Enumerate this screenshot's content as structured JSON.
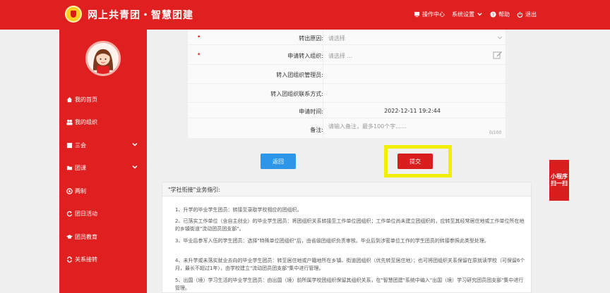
{
  "header": {
    "title": "网上共青团・智慧团建",
    "nav": {
      "operation_center": "操作中心",
      "system_settings": "系统设置",
      "help": "帮助",
      "logout": "退出"
    }
  },
  "sidebar": {
    "items": [
      {
        "label": "我的首页"
      },
      {
        "label": "我的组织"
      },
      {
        "label": "三会"
      },
      {
        "label": "团课"
      },
      {
        "label": "两制"
      },
      {
        "label": "团日活动"
      },
      {
        "label": "团员教育"
      },
      {
        "label": "关系接转"
      }
    ]
  },
  "form": {
    "transfer_reason": {
      "label": "转出原因:",
      "placeholder": "请选择"
    },
    "target_org": {
      "label": "申请转入组织:",
      "placeholder": "请选择 ..."
    },
    "target_admin": {
      "label": "转入团组织管理员:",
      "value": ""
    },
    "target_contact": {
      "label": "转入团组织联系方式:",
      "value": ""
    },
    "apply_time": {
      "label": "申请时间:",
      "value": "2022-12-11 19:2:44"
    },
    "remark": {
      "label": "备注:",
      "placeholder": "请输入备注，最多100个字......",
      "counter": "0/100"
    }
  },
  "buttons": {
    "back": "返回",
    "submit": "提交"
  },
  "guide": {
    "title": "\"学社衔接\"业务指引:",
    "paragraphs": [
      "1、升学的毕业学生团员：转接至录取学校相应的团组织。",
      "2、已落实工作单位（含自主创业）的毕业学生团员：将团组织关系转接至工作单位团组织；工作单位尚未建立团组织的，应转至其经常居住地或工作单位所在地的乡镇街道\"流动团员团支部\"。",
      "3、毕业后参军入伍的学生团员：选择\"特殊单位团组织\"后，由省级团组织负责审核。毕业后到涉密单位工作的学生团员的转接参照此类型处理。",
      "4、未升学或未落实就业去向的毕业学生团员：转至居住地或户籍地所在乡镇、街道团组织（优先转至居住地）；也可将团组织关系保留在原就读学校（可保留6个月，最长不超过1年），由学校建立\"流动团员团支部\"集中进行管理。",
      "5、出国（境）学习生活的毕业学生团员：由出国（境）前所属学校团组织保留其组织关系，在\"智慧团建\"系统中编入\"出国（境）学习研究团员团支部\"集中进行管理。"
    ]
  },
  "float_tab": {
    "label": "小程序扫一扫"
  },
  "colors": {
    "brand_red": "#e02020",
    "submit_red": "#d81e1e",
    "back_blue": "#2e96e8",
    "highlight_yellow": "#f2ee00"
  }
}
